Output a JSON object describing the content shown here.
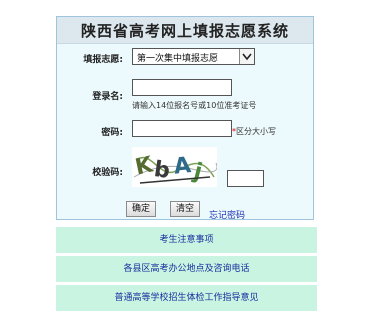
{
  "form": {
    "title": "陕西省高考网上填报志愿系统",
    "fill_label": "填报志愿:",
    "fill_selected": "第一次集中填报志愿",
    "login_label": "登录名:",
    "login_value": "",
    "login_hint": "请输入14位报名号或10位准考证号",
    "password_label": "密码:",
    "password_value": "",
    "password_star": "*",
    "password_hint": "区分大小写",
    "captcha_label": "校验码:",
    "captcha_image_text": "KbAj",
    "captcha_value": "",
    "confirm_label": "确定",
    "clear_label": "清空",
    "forgot_label": "忘记密码"
  },
  "links": [
    {
      "label": "考生注意事项"
    },
    {
      "label": "各县区高考办公地点及咨询电话"
    },
    {
      "label": "普通高等学校招生体检工作指导意见"
    }
  ],
  "colors": {
    "panel_bg": "#edfafd",
    "link_bg": "#c8f4e1",
    "link_text": "#1a2fa0",
    "required_star": "#d00000"
  }
}
